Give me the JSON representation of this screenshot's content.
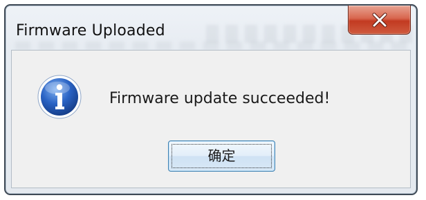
{
  "window": {
    "title": "Firmware Uploaded",
    "close_icon": "close-icon"
  },
  "dialog": {
    "icon": "info-icon",
    "message": "Firmware update succeeded!",
    "ok_label": "确定"
  },
  "colors": {
    "close_button": "#c23a21",
    "button_border": "#3c7fb1",
    "info_icon_blue": "#1f56b0"
  }
}
